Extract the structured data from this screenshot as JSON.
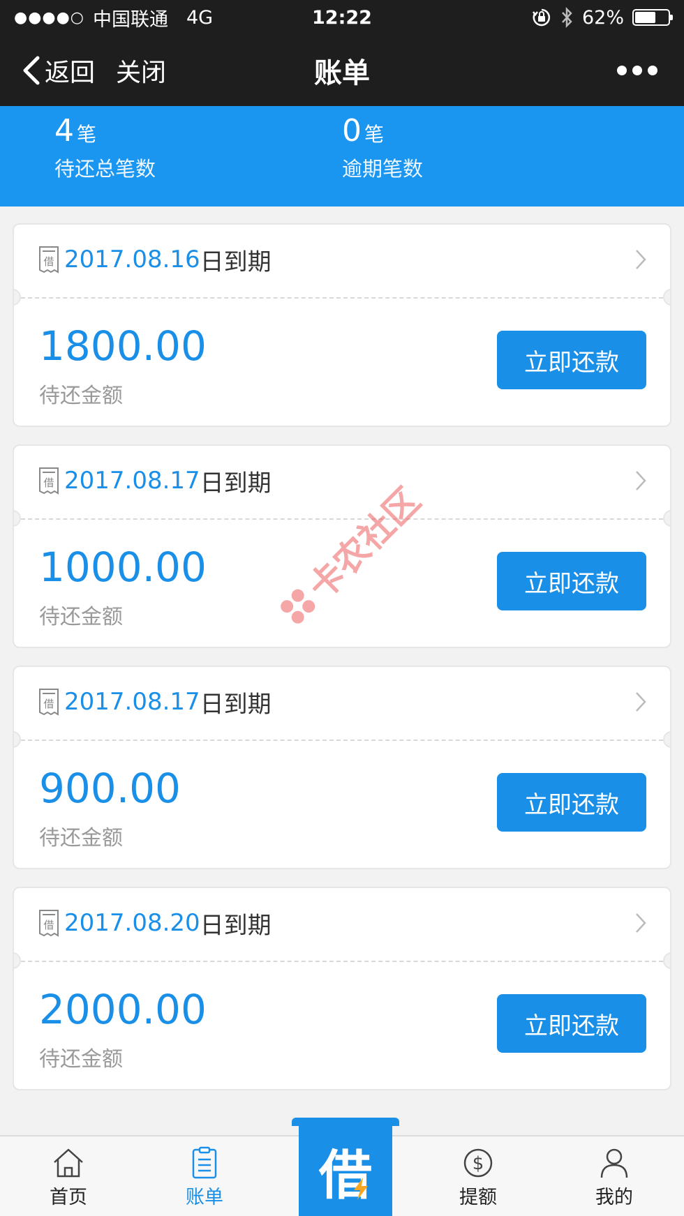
{
  "status_bar": {
    "signal": "●●●●○",
    "carrier": "中国联通",
    "network": "4G",
    "time": "12:22",
    "battery_percent": "62%",
    "battery_level": 0.62
  },
  "nav": {
    "back_label": "返回",
    "close_label": "关闭",
    "title": "账单"
  },
  "summary": {
    "pending_count": "4",
    "pending_unit": "笔",
    "pending_label": "待还总笔数",
    "overdue_count": "0",
    "overdue_unit": "笔",
    "overdue_label": "逾期笔数"
  },
  "bills": [
    {
      "date": "2017.08.16",
      "date_suffix": "日到期",
      "amount": "1800.00",
      "amount_label": "待还金额",
      "pay_label": "立即还款",
      "icon_char": "借"
    },
    {
      "date": "2017.08.17",
      "date_suffix": "日到期",
      "amount": "1000.00",
      "amount_label": "待还金额",
      "pay_label": "立即还款",
      "icon_char": "借"
    },
    {
      "date": "2017.08.17",
      "date_suffix": "日到期",
      "amount": "900.00",
      "amount_label": "待还金额",
      "pay_label": "立即还款",
      "icon_char": "借"
    },
    {
      "date": "2017.08.20",
      "date_suffix": "日到期",
      "amount": "2000.00",
      "amount_label": "待还金额",
      "pay_label": "立即还款",
      "icon_char": "借"
    }
  ],
  "watermark": {
    "text": "卡农社区"
  },
  "tabs": {
    "home": "首页",
    "bills": "账单",
    "borrow": "借",
    "limit": "提额",
    "mine": "我的"
  },
  "colors": {
    "accent": "#1a8fe8",
    "header_blue": "#1a96f0",
    "nav_dark": "#1e1e1f",
    "watermark": "#eb5050"
  }
}
